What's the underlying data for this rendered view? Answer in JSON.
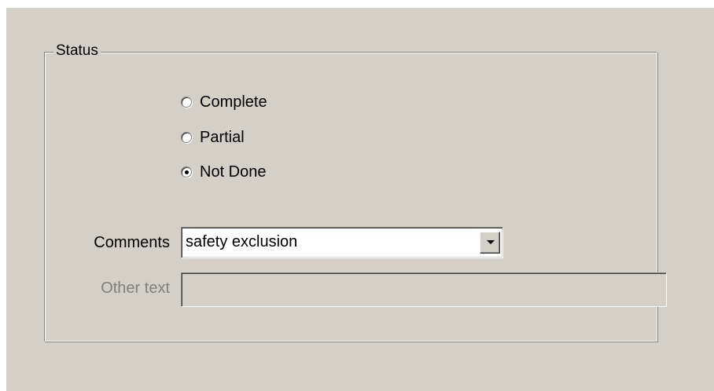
{
  "status_group": {
    "legend": "Status",
    "options": [
      {
        "label": "Complete",
        "selected": false
      },
      {
        "label": "Partial",
        "selected": false
      },
      {
        "label": "Not Done",
        "selected": true
      }
    ]
  },
  "comments": {
    "label": "Comments",
    "value": "safety exclusion"
  },
  "other_text": {
    "label": "Other text",
    "value": "",
    "disabled": true
  },
  "colors": {
    "dialog_background": "#d4d0c8",
    "disabled_text": "#808080"
  }
}
